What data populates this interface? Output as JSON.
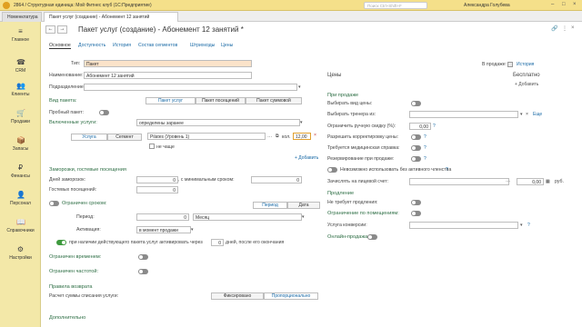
{
  "app": {
    "title": "2864 / Структурная единица: Мой Фитнес клуб (1С:Предприятие)",
    "search_placeholder": "Поиск Ctrl+Shift+F",
    "user": "Александра Голубева"
  },
  "tabs": [
    {
      "label": "Номенклатура"
    },
    {
      "label": "Пакет услуг (создание) - Абонемент 12 занятий"
    }
  ],
  "sidebar": {
    "items": [
      {
        "label": "Главное",
        "icon": "≡"
      },
      {
        "label": "CRM",
        "icon": "☎"
      },
      {
        "label": "Клиенты",
        "icon": "👥"
      },
      {
        "label": "Продажи",
        "icon": "🛒"
      },
      {
        "label": "Запасы",
        "icon": "📦"
      },
      {
        "label": "Финансы",
        "icon": "₽"
      },
      {
        "label": "Персонал",
        "icon": "👤"
      },
      {
        "label": "Справочники",
        "icon": "📖"
      },
      {
        "label": "Настройки",
        "icon": "⚙"
      }
    ]
  },
  "form": {
    "title": "Пакет услуг (создание) - Абонемент 12 занятий *",
    "links": [
      "Основное",
      "Доступность",
      "История",
      "Состав сегментов",
      "Штрихкоды",
      "Цены"
    ],
    "type_label": "Тип:",
    "type_value": "Пакет",
    "name_label": "Наименование:",
    "name_value": "Абонемент 12 занятий",
    "division_label": "Подразделение:",
    "division_value": "",
    "package_kind_label": "Вид пакета:",
    "package_kind_options": [
      "Пакет услуг",
      "Пакет посещений",
      "Пакет суммовой"
    ],
    "trial_label": "Пробный пакет:",
    "included_label": "Включенные услуги:",
    "included_value": "определены заранее",
    "svc_tabs": [
      "Услуга",
      "Сегмент"
    ],
    "svc_item": "Pilates (Уровень 1)",
    "qty_label": "кол.",
    "qty_value": "12,00",
    "not_more_label": "не чаще",
    "add_label": "+ Добавить",
    "freeze_header": "Заморозки, гостевые посещения",
    "freeze_days_label": "Дней заморозок:",
    "freeze_days_value": "0",
    "min_period_label": ", с минимальным сроком:",
    "min_period_value": "0",
    "guest_label": "Гостевых посещений:",
    "guest_value": "0",
    "limit_term_label": "Ограничен сроком:",
    "term_tabs": [
      "Период",
      "Дата"
    ],
    "period_label": "Период:",
    "period_value": "0",
    "period_unit": "Месяц",
    "activation_label": "Активация:",
    "activation_value": "в момент продажи",
    "auto_activate_text": "при наличии действующего пакета услуг активировать через",
    "auto_activate_days": "0",
    "auto_activate_suffix": "дней, после его окончания",
    "limit_time_label": "Ограничен временем:",
    "limit_freq_label": "Ограничен частотой:",
    "return_header": "Правила возврата",
    "return_calc_label": "Расчет суммы списания услуги:",
    "return_options": [
      "Фиксировано",
      "Пропорционально"
    ],
    "extra_header": "Дополнительно"
  },
  "right": {
    "on_sale_label": "В продаже:",
    "history_link": "История",
    "prices_header": "Цены",
    "free_label": "Бесплатно",
    "add_price_label": "+ Добавить",
    "on_sale_header": "При продаже",
    "choose_price_label": "Выбирать вид цены:",
    "choose_trainer_label": "Выбирать тренера из:",
    "eshe_link": "Еще",
    "discount_label": "Ограничить ручную скидку (%):",
    "discount_value": "0,00",
    "correct_price_label": "Разрешить корректировку цены:",
    "med_cert_label": "Требуется медицинская справка:",
    "reserve_label": "Резервирование при продаже:",
    "no_active_label": "Невозможно использовать без активного членства",
    "credit_label": "Зачислять на лицевой счет:",
    "credit_value": "0,00",
    "currency": "руб.",
    "prolong_header": "Продление",
    "prolong_label": "Не требует продления:",
    "premises_header": "Ограничение по помещениям:",
    "conversion_label": "Услуга конверсии:",
    "online_label": "Онлайн-продажа:"
  }
}
